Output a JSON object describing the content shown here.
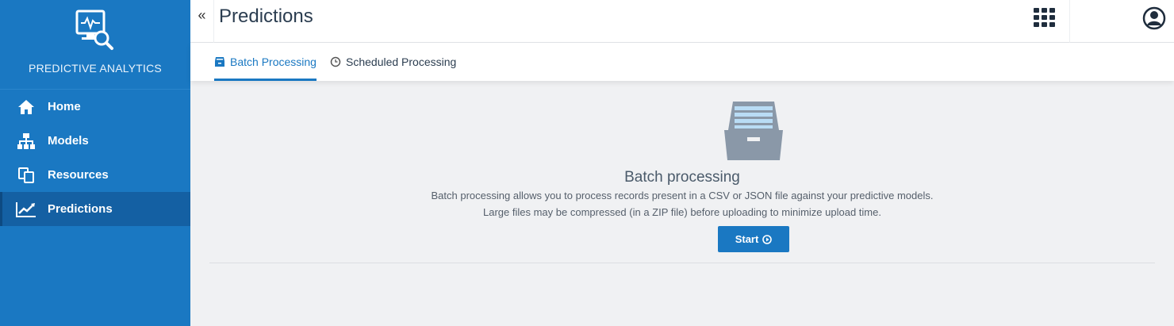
{
  "sidebar": {
    "brand": "PREDICTIVE ANALYTICS",
    "items": [
      {
        "label": "Home",
        "icon": "home-icon"
      },
      {
        "label": "Models",
        "icon": "sitemap-icon"
      },
      {
        "label": "Resources",
        "icon": "copy-icon"
      },
      {
        "label": "Predictions",
        "icon": "line-chart-icon",
        "active": true
      }
    ]
  },
  "header": {
    "collapse": "«",
    "title": "Predictions"
  },
  "tabs": [
    {
      "label": "Batch Processing",
      "icon": "inbox-icon",
      "active": true
    },
    {
      "label": "Scheduled Processing",
      "icon": "clock-icon"
    }
  ],
  "batch": {
    "title": "Batch processing",
    "line1": "Batch processing allows you to process records present in a CSV or JSON file against your predictive models.",
    "line2": "Large files may be compressed (in a ZIP file) before uploading to minimize upload time.",
    "start_label": "Start"
  },
  "colors": {
    "sidebar": "#1a78c2",
    "sidebar_active": "#1460a3",
    "accent": "#1a78c2",
    "background": "#f0f1f3"
  }
}
